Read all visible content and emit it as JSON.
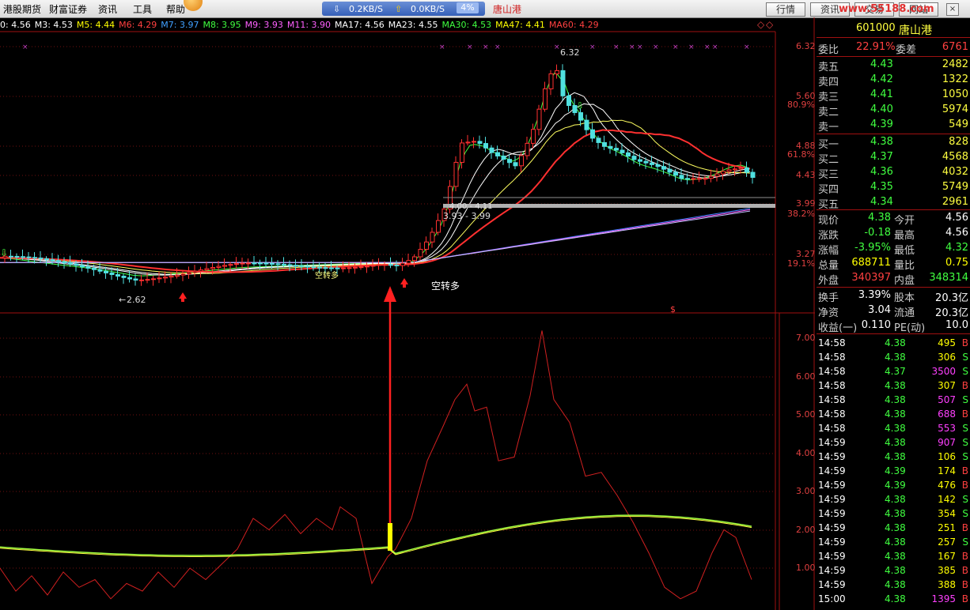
{
  "menu": {
    "items": [
      "港股期货",
      "财富证券",
      "资讯",
      "工具",
      "帮助"
    ]
  },
  "speed": {
    "down": "0.2KB/S",
    "up": "0.0KB/S",
    "pct": "4%",
    "stock": "唐山港"
  },
  "tabs": [
    "行情",
    "资讯",
    "交易",
    "网站"
  ],
  "watermark": "www.55188.com",
  "ma": [
    {
      "label": "0: 4.56",
      "color": "#ffffff"
    },
    {
      "label": "M3: 4.53",
      "color": "#ffffff"
    },
    {
      "label": "M5: 4.44",
      "color": "#ffff00"
    },
    {
      "label": "M6: 4.29",
      "color": "#ff4040"
    },
    {
      "label": "M7: 3.97",
      "color": "#40a0ff"
    },
    {
      "label": "M8: 3.95",
      "color": "#40ff40"
    },
    {
      "label": "M9: 3.93",
      "color": "#ff60ff"
    },
    {
      "label": "M11: 3.90",
      "color": "#ff60ff"
    },
    {
      "label": "MA17: 4.56",
      "color": "#ffffff"
    },
    {
      "label": "MA23: 4.55",
      "color": "#ffffff"
    },
    {
      "label": "MA30: 4.53",
      "color": "#40ff40"
    },
    {
      "label": "MA47: 4.41",
      "color": "#ffff00"
    },
    {
      "label": "MA60: 4.29",
      "color": "#ff4040"
    }
  ],
  "price_axis": [
    "6.32",
    "5.60",
    "80.9%",
    "4.88",
    "61.8%",
    "4.43",
    "3.99",
    "38.2%",
    "3.27",
    "19.1%"
  ],
  "ind_axis": [
    "7.00",
    "6.00",
    "5.00",
    "4.00",
    "3.00",
    "2.00",
    "1.00"
  ],
  "chart": {
    "high_label": "6.32",
    "low_label": "2.62",
    "range_label": "3.93 - 3.99",
    "range_label2": "4.00 - 4.11",
    "signal": "空转多",
    "signal2": "空转多"
  },
  "quote": {
    "code": "601000",
    "name": "唐山港",
    "wb": {
      "label": "委比",
      "value": "22.91%",
      "label2": "委差",
      "value2": "6761"
    },
    "asks": [
      {
        "label": "卖五",
        "price": "4.43",
        "vol": "2482"
      },
      {
        "label": "卖四",
        "price": "4.42",
        "vol": "1322"
      },
      {
        "label": "卖三",
        "price": "4.41",
        "vol": "1050"
      },
      {
        "label": "卖二",
        "price": "4.40",
        "vol": "5974"
      },
      {
        "label": "卖一",
        "price": "4.39",
        "vol": "549"
      }
    ],
    "bids": [
      {
        "label": "买一",
        "price": "4.38",
        "vol": "828"
      },
      {
        "label": "买二",
        "price": "4.37",
        "vol": "4568"
      },
      {
        "label": "买三",
        "price": "4.36",
        "vol": "4032"
      },
      {
        "label": "买四",
        "price": "4.35",
        "vol": "5749"
      },
      {
        "label": "买五",
        "price": "4.34",
        "vol": "2961"
      }
    ],
    "stats": [
      {
        "l1": "现价",
        "v1": "4.38",
        "c1": "#40ff40",
        "l2": "今开",
        "v2": "4.56",
        "c2": "#ffffff"
      },
      {
        "l1": "涨跌",
        "v1": "-0.18",
        "c1": "#40ff40",
        "l2": "最高",
        "v2": "4.56",
        "c2": "#ffffff"
      },
      {
        "l1": "涨幅",
        "v1": "-3.95%",
        "c1": "#40ff40",
        "l2": "最低",
        "v2": "4.32",
        "c2": "#40ff40"
      },
      {
        "l1": "总量",
        "v1": "688711",
        "c1": "#ffff00",
        "l2": "量比",
        "v2": "0.75",
        "c2": "#ffff00"
      },
      {
        "l1": "外盘",
        "v1": "340397",
        "c1": "#ff4040",
        "l2": "内盘",
        "v2": "348314",
        "c2": "#40ff40"
      }
    ],
    "stats2": [
      {
        "l1": "换手",
        "v1": "3.39%",
        "l2": "股本",
        "v2": "20.3亿"
      },
      {
        "l1": "净资",
        "v1": "3.04",
        "l2": "流通",
        "v2": "20.3亿"
      },
      {
        "l1": "收益(一)",
        "v1": "0.110",
        "l2": "PE(动)",
        "v2": "10.0"
      }
    ],
    "ticks": [
      {
        "t": "14:58",
        "p": "4.38",
        "v": "495",
        "s": "B",
        "pc": "#40ff40",
        "vc": "#ffff00"
      },
      {
        "t": "14:58",
        "p": "4.38",
        "v": "306",
        "s": "S",
        "pc": "#40ff40",
        "vc": "#ffff00"
      },
      {
        "t": "14:58",
        "p": "4.37",
        "v": "3500",
        "s": "S",
        "pc": "#40ff40",
        "vc": "#ff40ff"
      },
      {
        "t": "14:58",
        "p": "4.38",
        "v": "307",
        "s": "B",
        "pc": "#40ff40",
        "vc": "#ffff00"
      },
      {
        "t": "14:58",
        "p": "4.38",
        "v": "507",
        "s": "S",
        "pc": "#40ff40",
        "vc": "#ff40ff"
      },
      {
        "t": "14:58",
        "p": "4.38",
        "v": "688",
        "s": "B",
        "pc": "#40ff40",
        "vc": "#ff40ff"
      },
      {
        "t": "14:58",
        "p": "4.38",
        "v": "553",
        "s": "S",
        "pc": "#40ff40",
        "vc": "#ff40ff"
      },
      {
        "t": "14:59",
        "p": "4.38",
        "v": "907",
        "s": "S",
        "pc": "#40ff40",
        "vc": "#ff40ff"
      },
      {
        "t": "14:59",
        "p": "4.38",
        "v": "106",
        "s": "S",
        "pc": "#40ff40",
        "vc": "#ffff00"
      },
      {
        "t": "14:59",
        "p": "4.39",
        "v": "174",
        "s": "B",
        "pc": "#40ff40",
        "vc": "#ffff00"
      },
      {
        "t": "14:59",
        "p": "4.39",
        "v": "476",
        "s": "B",
        "pc": "#40ff40",
        "vc": "#ffff00"
      },
      {
        "t": "14:59",
        "p": "4.38",
        "v": "142",
        "s": "S",
        "pc": "#40ff40",
        "vc": "#ffff00"
      },
      {
        "t": "14:59",
        "p": "4.38",
        "v": "354",
        "s": "S",
        "pc": "#40ff40",
        "vc": "#ffff00"
      },
      {
        "t": "14:59",
        "p": "4.38",
        "v": "251",
        "s": "B",
        "pc": "#40ff40",
        "vc": "#ffff00"
      },
      {
        "t": "14:59",
        "p": "4.38",
        "v": "257",
        "s": "S",
        "pc": "#40ff40",
        "vc": "#ffff00"
      },
      {
        "t": "14:59",
        "p": "4.38",
        "v": "167",
        "s": "B",
        "pc": "#40ff40",
        "vc": "#ffff00"
      },
      {
        "t": "14:59",
        "p": "4.38",
        "v": "385",
        "s": "B",
        "pc": "#40ff40",
        "vc": "#ffff00"
      },
      {
        "t": "14:59",
        "p": "4.38",
        "v": "388",
        "s": "B",
        "pc": "#40ff40",
        "vc": "#ffff00"
      },
      {
        "t": "15:00",
        "p": "4.38",
        "v": "1395",
        "s": "B",
        "pc": "#40ff40",
        "vc": "#ff40ff"
      }
    ]
  }
}
